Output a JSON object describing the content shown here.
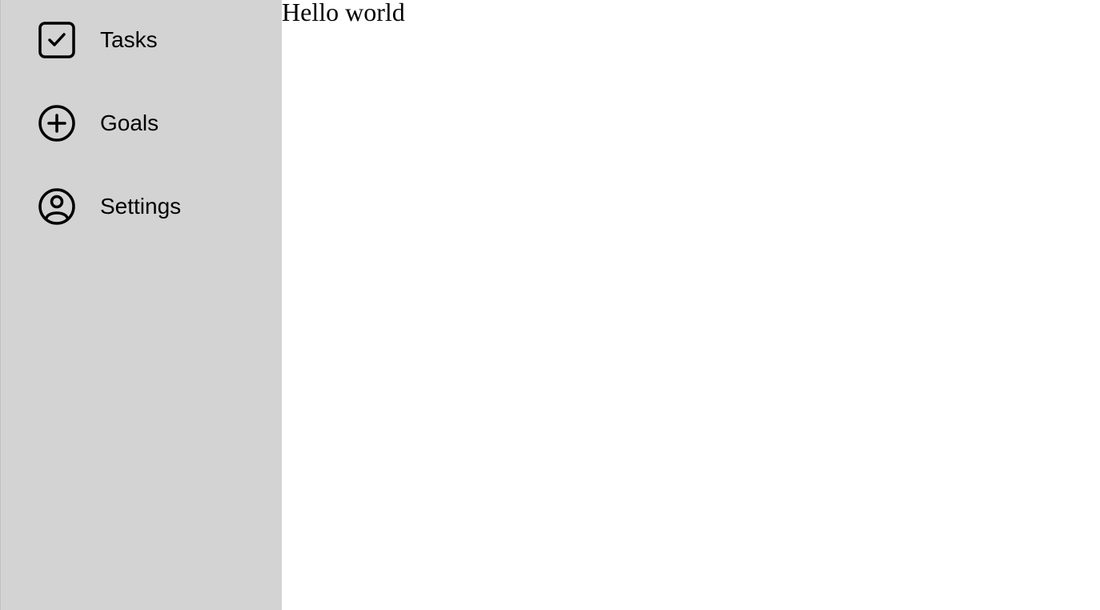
{
  "sidebar": {
    "background": "#d3d3d3",
    "items": [
      {
        "label": "Tasks",
        "icon": "checkbox-check-icon"
      },
      {
        "label": "Goals",
        "icon": "circle-plus-icon"
      },
      {
        "label": "Settings",
        "icon": "user-circle-icon"
      }
    ]
  },
  "main": {
    "text": "Hello world",
    "background": "#ffffff"
  }
}
